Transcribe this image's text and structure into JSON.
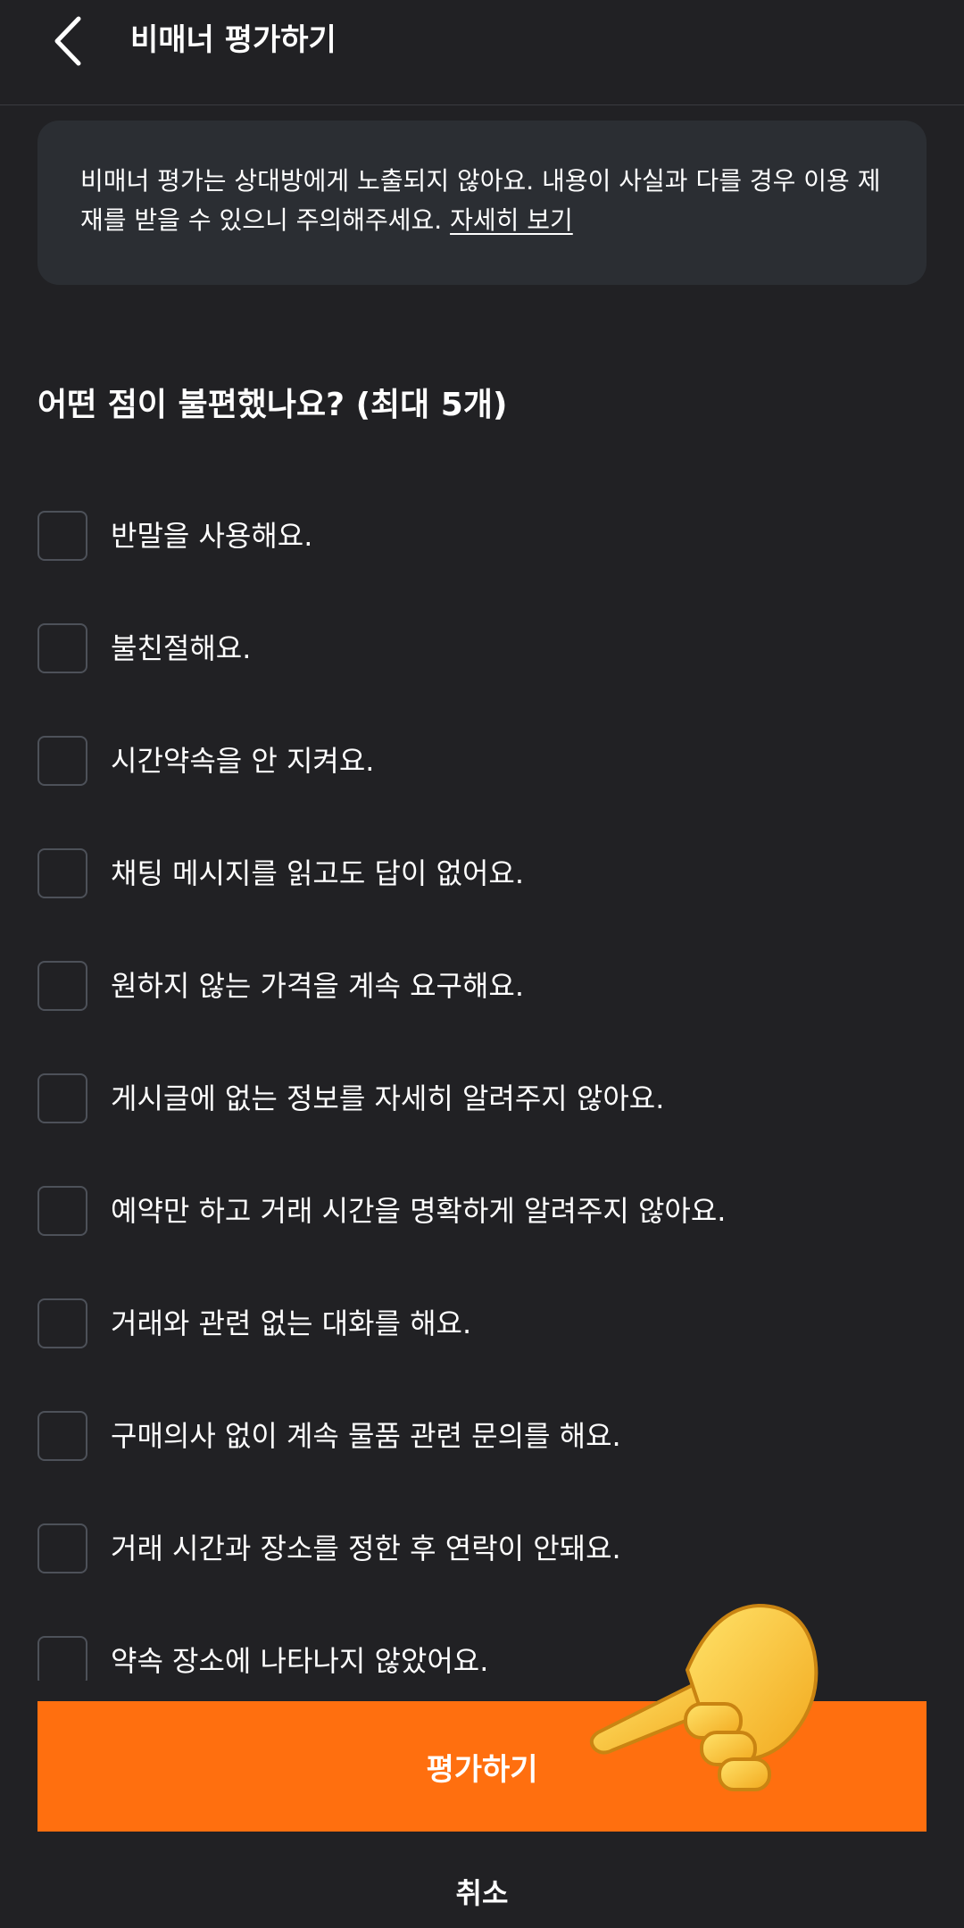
{
  "header": {
    "title": "비매너 평가하기",
    "back_icon": "chevron-left-icon"
  },
  "notice": {
    "text": "비매너 평가는 상대방에게 노출되지 않아요. 내용이 사실과 다를 경우 이용 제재를 받을 수 있으니 주의해주세요.",
    "link_label": "자세히 보기"
  },
  "question": "어떤 점이 불편했나요? (최대 5개)",
  "options": [
    {
      "label": "반말을 사용해요.",
      "checked": false
    },
    {
      "label": "불친절해요.",
      "checked": false
    },
    {
      "label": "시간약속을 안 지켜요.",
      "checked": false
    },
    {
      "label": "채팅 메시지를 읽고도 답이 없어요.",
      "checked": false
    },
    {
      "label": "원하지 않는 가격을 계속 요구해요.",
      "checked": false
    },
    {
      "label": "게시글에 없는 정보를 자세히 알려주지 않아요.",
      "checked": false
    },
    {
      "label": "예약만 하고 거래 시간을 명확하게 알려주지 않아요.",
      "checked": false
    },
    {
      "label": "거래와 관련 없는 대화를 해요.",
      "checked": false
    },
    {
      "label": "구매의사 없이 계속 물품 관련 문의를 해요.",
      "checked": false
    },
    {
      "label": "거래 시간과 장소를 정한 후 연락이 안돼요.",
      "checked": false
    },
    {
      "label": "약속 장소에 나타나지 않았어요.",
      "checked": false
    }
  ],
  "buttons": {
    "submit_label": "평가하기",
    "cancel_label": "취소"
  },
  "overlay": {
    "icon": "pointing-hand-icon"
  },
  "colors": {
    "background": "#212124",
    "accent": "#ff6f0f",
    "notice_bg": "#2b2e33"
  }
}
